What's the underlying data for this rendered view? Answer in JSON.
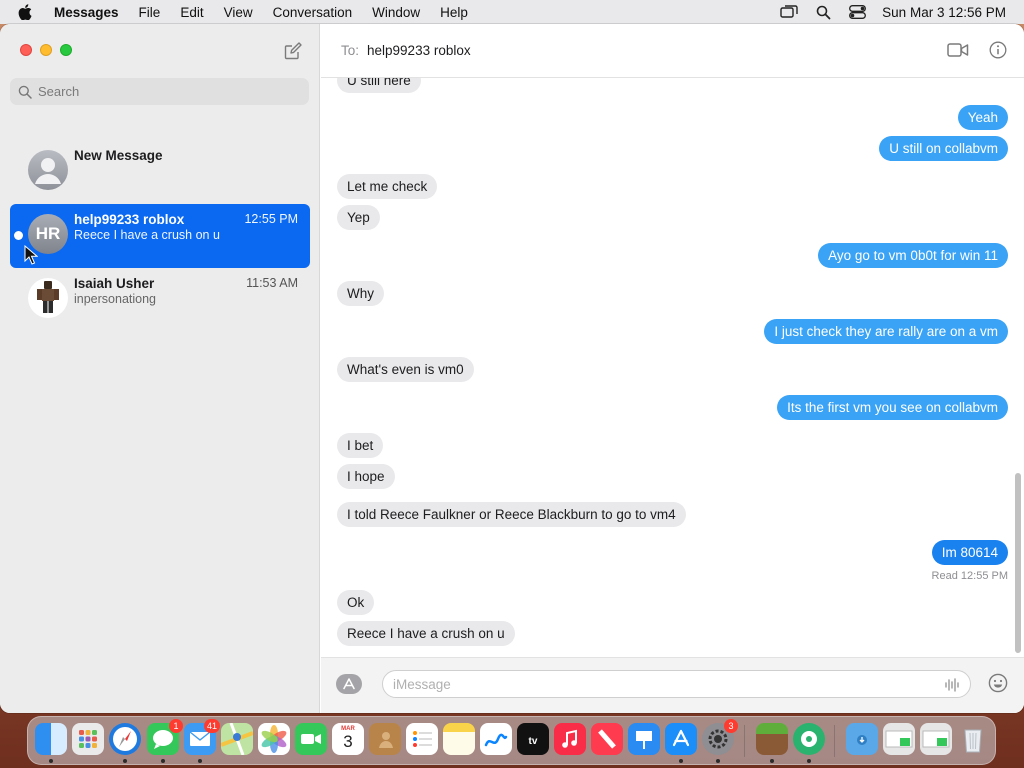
{
  "menubar": {
    "app_name": "Messages",
    "menus": [
      "File",
      "Edit",
      "View",
      "Conversation",
      "Window",
      "Help"
    ],
    "clock": "Sun Mar 3  12:56 PM"
  },
  "sidebar": {
    "search_placeholder": "Search",
    "conversations": [
      {
        "name": "New Message",
        "time": "",
        "preview": "",
        "avatar": "generic"
      },
      {
        "name": "help99233 roblox",
        "time": "12:55 PM",
        "preview": "Reece I have a crush on u",
        "initials": "HR",
        "selected": true,
        "unread": true
      },
      {
        "name": "Isaiah Usher",
        "time": "11:53 AM",
        "preview": "inpersonationg",
        "avatar": "photo"
      }
    ]
  },
  "header": {
    "to_label": "To:",
    "recipient": "help99233 roblox"
  },
  "messages": [
    {
      "text": "U still here",
      "from": "them"
    },
    {
      "text": "Yeah",
      "from": "me"
    },
    {
      "text": "U still on collabvm",
      "from": "me"
    },
    {
      "text": "Let me check",
      "from": "them"
    },
    {
      "text": "Yep",
      "from": "them"
    },
    {
      "text": "Ayo go to vm 0b0t for win 11",
      "from": "me"
    },
    {
      "text": "Why",
      "from": "them"
    },
    {
      "text": "I just check they are rally are on a vm",
      "from": "me"
    },
    {
      "text": "What's even is vm0",
      "from": "them"
    },
    {
      "text": "Its the first vm you see on collabvm",
      "from": "me"
    },
    {
      "text": "I bet",
      "from": "them"
    },
    {
      "text": "I hope",
      "from": "them"
    },
    {
      "text": "I told Reece Faulkner or Reece Blackburn to go to vm4",
      "from": "them"
    },
    {
      "text": "Im 80614",
      "from": "me"
    },
    {
      "text": "Ok",
      "from": "them"
    },
    {
      "text": "Reece I have a crush on u",
      "from": "them"
    }
  ],
  "read_receipt": {
    "label": "Read",
    "time": "12:55 PM"
  },
  "composer": {
    "placeholder": "iMessage"
  },
  "dock": {
    "messages_badge": "1",
    "mail_badge": "41",
    "settings_badge": "3",
    "calendar_month": "MAR",
    "calendar_day": "3"
  },
  "colors": {
    "accent_selected": "#0a68f1",
    "outgoing_bubble": "#3aa3f5",
    "incoming_bubble": "#e9e9eb"
  }
}
